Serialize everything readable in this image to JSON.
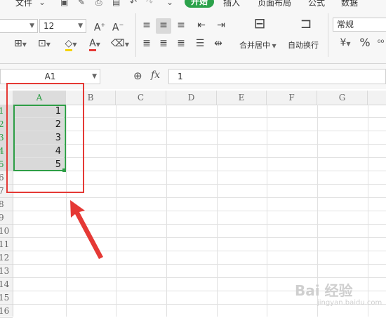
{
  "menubar": {
    "file_label": "文件",
    "tabs": [
      "开始",
      "插入",
      "页面布局",
      "公式",
      "数据"
    ]
  },
  "ribbon": {
    "font_size": "12",
    "number_format": "常规",
    "merge_label": "合并居中",
    "wrap_label": "自动换行",
    "percent_symbol": "%"
  },
  "formula_bar": {
    "name_box": "A1",
    "fx_label": "fx",
    "formula_value": "1"
  },
  "grid": {
    "columns": [
      "A",
      "B",
      "C",
      "D",
      "E",
      "F",
      "G"
    ],
    "rows": [
      "1",
      "2",
      "3",
      "4",
      "5",
      "6",
      "7",
      "8",
      "9",
      "10",
      "11",
      "12",
      "13",
      "14",
      "15",
      "16"
    ],
    "cells_a": [
      "1",
      "2",
      "3",
      "4",
      "5"
    ],
    "active_column": "A"
  },
  "watermark": {
    "text": "Bai 经验",
    "url": "jingyan.baidu.com"
  },
  "colors": {
    "accent_green": "#2ca24b",
    "annotation_red": "#e53935",
    "selection_green": "#2e9e46"
  },
  "icons": [
    "save-icon",
    "format-painter-icon",
    "print-icon",
    "undo-icon",
    "redo-icon",
    "border-icon",
    "fill-color-icon",
    "font-color-icon",
    "clear-icon",
    "align-icon",
    "merge-icon",
    "wrap-icon",
    "currency-icon",
    "zoom-search-icon",
    "annotation-arrow-icon"
  ]
}
